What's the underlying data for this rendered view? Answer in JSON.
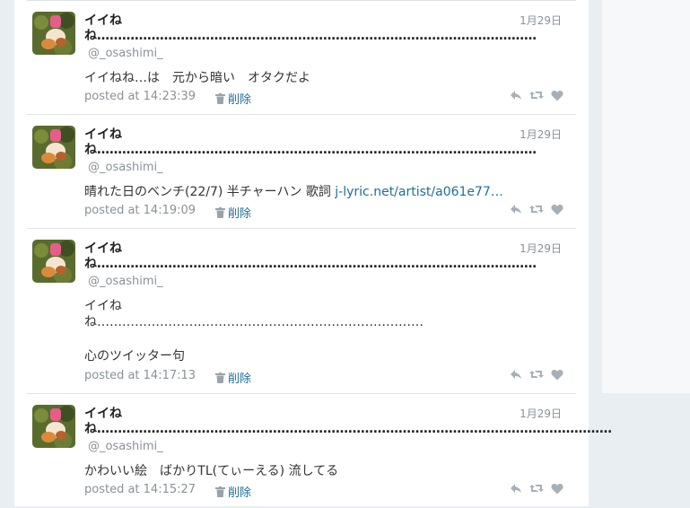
{
  "tweets": [
    {
      "name_line1": "イイね",
      "name_line2": "ね……………………………………………………………………………………………",
      "screen_name": "@_osashimi_",
      "date": "1月29日",
      "text": "イイねね…は　元から暗い　オタクだよ",
      "posted": "posted at 14:23:39",
      "delete_label": "削除"
    },
    {
      "name_line1": "イイね",
      "name_line2": "ね……………………………………………………………………………………………",
      "screen_name": "@_osashimi_",
      "date": "1月29日",
      "text": "晴れた日のベンチ(22/7) 半チャーハン 歌詞 ",
      "link": "j-lyric.net/artist/a061e77…",
      "posted": "posted at 14:19:09",
      "delete_label": "削除"
    },
    {
      "name_line1": "イイね",
      "name_line2": "ね……………………………………………………………………………………………",
      "screen_name": "@_osashimi_",
      "date": "1月29日",
      "text_line1": "イイね",
      "text_line2": "ね……………………………………………………………………",
      "text_line3": "心のツイッター句",
      "posted": "posted at 14:17:13",
      "delete_label": "削除"
    },
    {
      "name_line1": "イイね",
      "name_line2": "ね……………………………………………………………………………………………………………",
      "screen_name": "@_osashimi_",
      "date": "1月29日",
      "text": "かわいい絵　ばかりTL(てぃーえる) 流してる",
      "posted": "posted at 14:15:27",
      "delete_label": "削除"
    }
  ]
}
